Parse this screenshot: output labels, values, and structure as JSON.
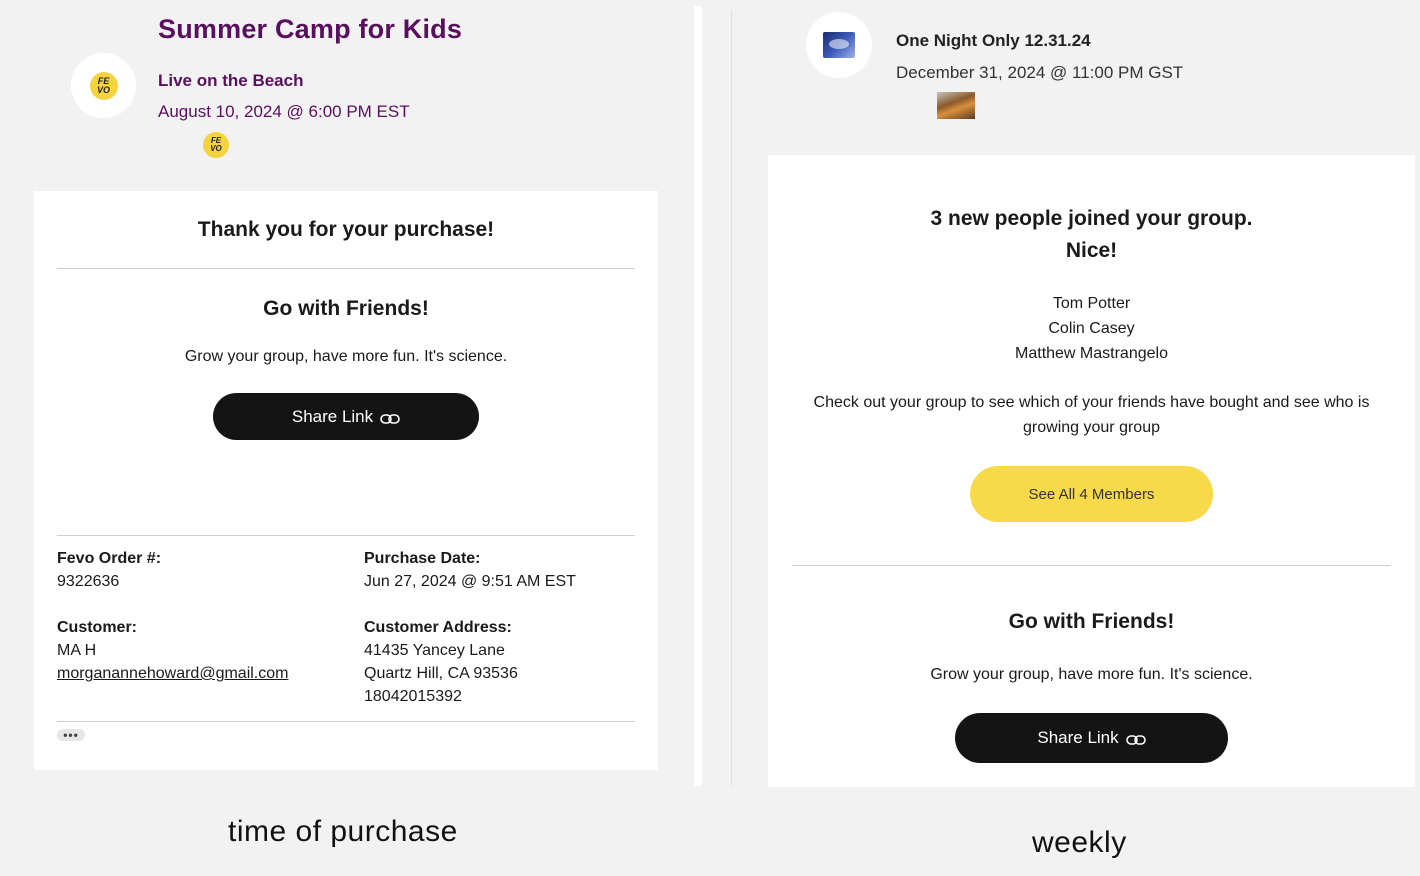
{
  "left": {
    "event_title": "Summer Camp for Kids",
    "event_subtitle": "Live on the Beach",
    "event_datetime": "August 10, 2024 @ 6:00 PM EST",
    "logo_text_top": "FE",
    "logo_text_bottom": "VO",
    "card": {
      "thank_you": "Thank you for your purchase!",
      "go_with_friends": "Go with Friends!",
      "tagline": "Grow your group, have more fun. It's science.",
      "share_button": "Share Link",
      "order_label": "Fevo Order #:",
      "order_value": "9322636",
      "purchase_date_label": "Purchase Date:",
      "purchase_date_value": "Jun 27, 2024 @ 9:51 AM EST",
      "customer_label": "Customer:",
      "customer_name": "MA H",
      "customer_email": "morganannehoward@gmail.com",
      "address_label": "Customer Address:",
      "address_line1": "41435 Yancey Lane",
      "address_line2": "Quartz Hill, CA 93536",
      "address_phone": "18042015392",
      "more_dots": "•••"
    },
    "caption": "time of purchase"
  },
  "right": {
    "event_title": "One Night Only 12.31.24",
    "event_datetime": "December 31, 2024 @ 11:00 PM GST",
    "card": {
      "headline_line1": "3 new people joined your group.",
      "headline_line2": "Nice!",
      "members": [
        "Tom Potter",
        "Colin Casey",
        "Matthew Mastrangelo"
      ],
      "check_out_line1": "Check out your group to see which of your friends have bought and see who is",
      "check_out_line2": "growing your group",
      "see_all_button": "See All 4 Members",
      "go_with_friends": "Go with Friends!",
      "tagline": "Grow your group, have more fun. It's science.",
      "share_button": "Share Link"
    },
    "caption": "weekly"
  },
  "colors": {
    "brand_purple": "#5a0f5e",
    "fevo_yellow": "#f5d33f",
    "button_dark": "#141414",
    "button_yellow": "#f7d94a",
    "background": "#f2f2f2"
  },
  "icons": [
    "fevo-logo-icon",
    "link-icon",
    "more-dots-icon",
    "event-thumbnail-icon",
    "food-thumbnail-icon"
  ]
}
